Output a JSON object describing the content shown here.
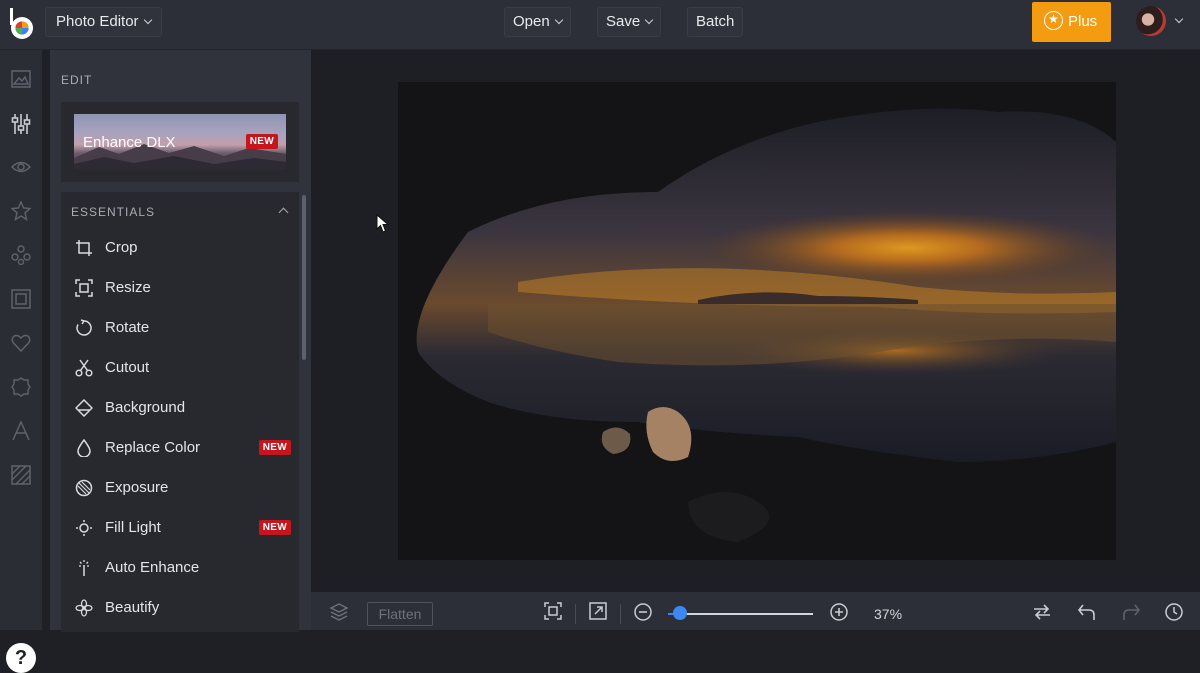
{
  "header": {
    "app_menu": "Photo Editor",
    "open_label": "Open",
    "save_label": "Save",
    "batch_label": "Batch",
    "plus_label": "Plus"
  },
  "panel": {
    "title": "EDIT",
    "enhance_label": "Enhance DLX",
    "enhance_badge": "NEW",
    "section_title": "ESSENTIALS",
    "tools": [
      {
        "label": "Crop",
        "icon": "crop-icon",
        "badge": ""
      },
      {
        "label": "Resize",
        "icon": "resize-icon",
        "badge": ""
      },
      {
        "label": "Rotate",
        "icon": "rotate-icon",
        "badge": ""
      },
      {
        "label": "Cutout",
        "icon": "scissors-icon",
        "badge": ""
      },
      {
        "label": "Background",
        "icon": "background-icon",
        "badge": ""
      },
      {
        "label": "Replace Color",
        "icon": "droplet-icon",
        "badge": "NEW"
      },
      {
        "label": "Exposure",
        "icon": "exposure-icon",
        "badge": ""
      },
      {
        "label": "Fill Light",
        "icon": "fill-light-icon",
        "badge": "NEW"
      },
      {
        "label": "Auto Enhance",
        "icon": "wand-icon",
        "badge": ""
      },
      {
        "label": "Beautify",
        "icon": "beautify-icon",
        "badge": ""
      }
    ]
  },
  "rail": {
    "items": [
      "image-icon",
      "sliders-icon",
      "eye-icon",
      "star-icon",
      "graphics-icon",
      "frame-icon",
      "heart-icon",
      "badge-icon",
      "text-icon",
      "texture-icon"
    ],
    "active": "sliders-icon",
    "help_label": "?"
  },
  "bottom": {
    "flatten_label": "Flatten",
    "zoom_text": "37%",
    "zoom_fraction": 0.08
  },
  "colors": {
    "accent": "#f39b11",
    "badge": "#c4161c",
    "zoom": "#3d87f0"
  }
}
